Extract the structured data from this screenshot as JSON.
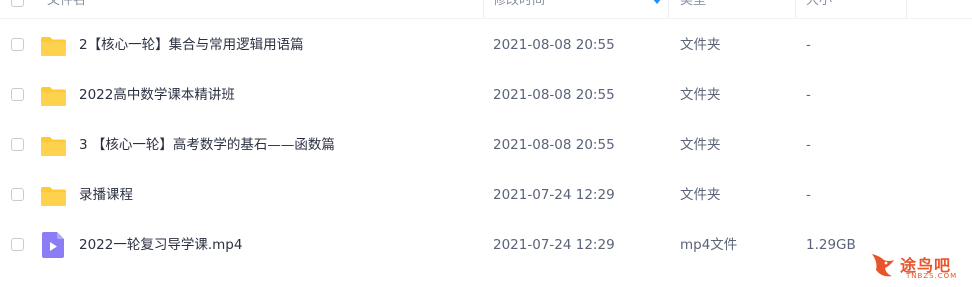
{
  "header": {
    "col_name": "文件名",
    "col_modified": "修改时间",
    "col_type": "类型",
    "col_size": "大小"
  },
  "rows": [
    {
      "name": "2【核心一轮】集合与常用逻辑用语篇",
      "modified": "2021-08-08 20:55",
      "type": "文件夹",
      "size": "-",
      "icon": "folder-icon"
    },
    {
      "name": "2022高中数学课本精讲班",
      "modified": "2021-08-08 20:55",
      "type": "文件夹",
      "size": "-",
      "icon": "folder-icon"
    },
    {
      "name": "3 【核心一轮】高考数学的基石——函数篇",
      "modified": "2021-08-08 20:55",
      "type": "文件夹",
      "size": "-",
      "icon": "folder-icon"
    },
    {
      "name": "录播课程",
      "modified": "2021-07-24 12:29",
      "type": "文件夹",
      "size": "-",
      "icon": "folder-icon"
    },
    {
      "name": "2022一轮复习导学课.mp4",
      "modified": "2021-07-24 12:29",
      "type": "mp4文件",
      "size": "1.29GB",
      "icon": "video-file-icon"
    }
  ],
  "watermark": {
    "text": "途鸟吧",
    "sub": "TNBZS.COM"
  },
  "colors": {
    "folder": "#ffc933",
    "video": "#8c7cf6",
    "accent": "#1f8fff",
    "watermark": "#e8552b"
  }
}
